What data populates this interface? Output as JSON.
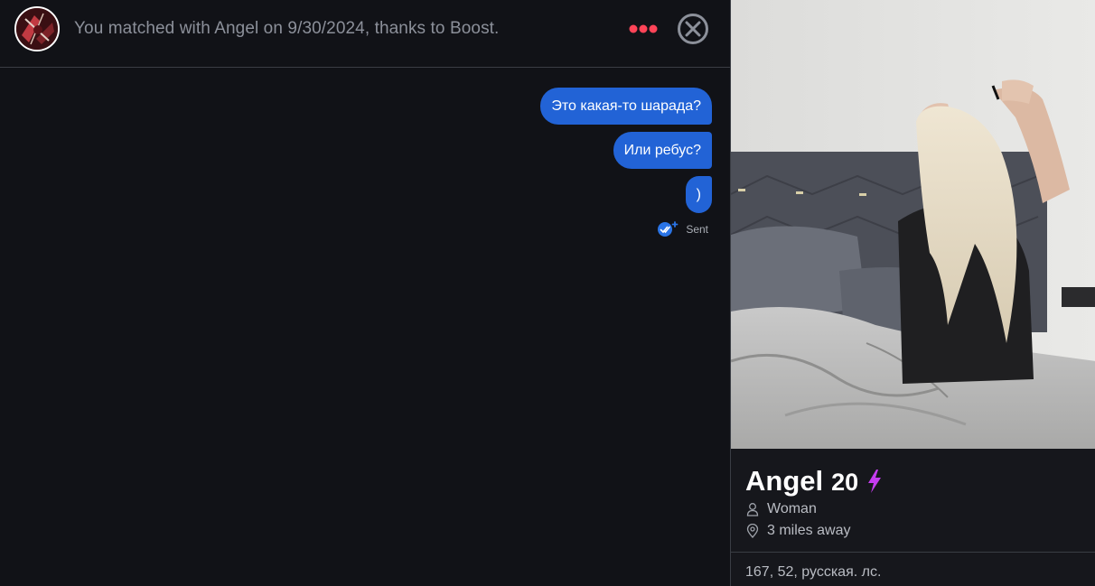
{
  "header": {
    "match_text": "You matched with Angel on 9/30/2024, thanks to Boost.",
    "more_icon": "more-dots-icon",
    "close_icon": "close-circle-icon"
  },
  "messages": [
    {
      "text": "Это какая-то шарада?"
    },
    {
      "text": "Или ребус?"
    },
    {
      "text": ")"
    }
  ],
  "status": {
    "label": "Sent",
    "icon": "double-check-icon"
  },
  "profile": {
    "name": "Angel",
    "age": "20",
    "boost_icon": "lightning-bolt-icon",
    "gender": "Woman",
    "distance": "3 miles away",
    "bio": "167, 52, русская. лс."
  },
  "colors": {
    "bubble": "#2263d6",
    "accent_dots": "#ff4458",
    "boost": "#c53cf0",
    "background": "#111217"
  }
}
